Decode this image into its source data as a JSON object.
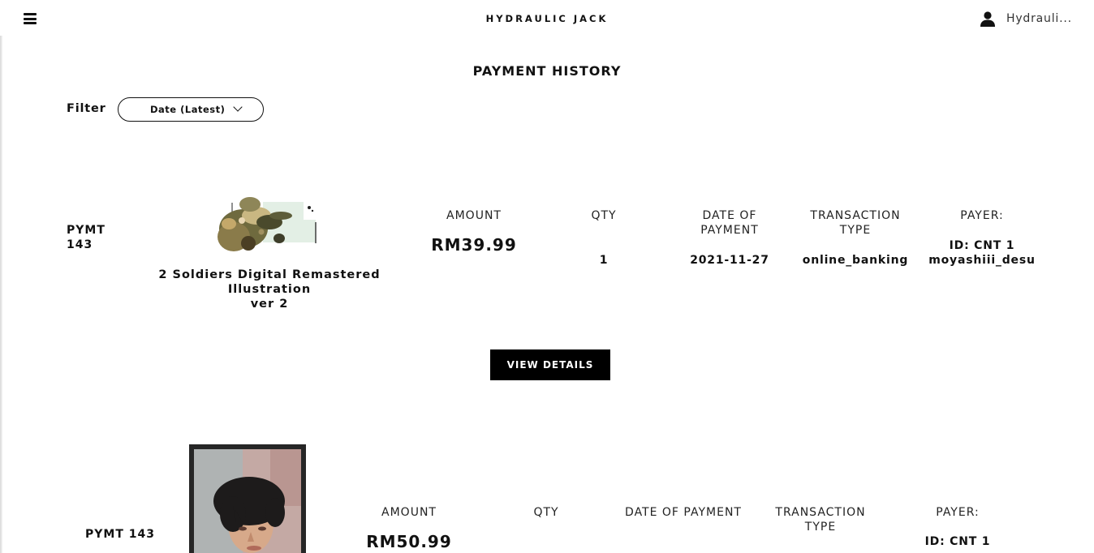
{
  "header": {
    "brand": "HYDRAULIC JACK",
    "user_name": "Hydrauli..."
  },
  "page": {
    "title": "PAYMENT HISTORY"
  },
  "filter": {
    "label": "Filter",
    "selected": "Date (Latest)"
  },
  "records": [
    {
      "id_line1": "PYMT",
      "id_line2": "143",
      "product_name_line1": "2 Soldiers Digital Remastered Illustration",
      "product_name_line2": "ver 2",
      "amount_label": "AMOUNT",
      "amount": "RM39.99",
      "qty_label": "QTY",
      "qty": "1",
      "date_label_line1": "DATE OF",
      "date_label_line2": "PAYMENT",
      "date": "2021-11-27",
      "type_label_line1": "TRANSACTION",
      "type_label_line2": "TYPE",
      "type": "online_banking",
      "payer_label": "PAYER:",
      "payer_id": "ID: CNT 1",
      "payer_name": "moyashiii_desu",
      "button": "VIEW DETAILS"
    },
    {
      "id": "PYMT 143",
      "amount_label": "AMOUNT",
      "amount": "RM50.99",
      "qty_label": "QTY",
      "date_label": "DATE OF PAYMENT",
      "type_label_line1": "TRANSACTION",
      "type_label_line2": "TYPE",
      "payer_label": "PAYER:",
      "payer_id": "ID: CNT 1"
    }
  ]
}
